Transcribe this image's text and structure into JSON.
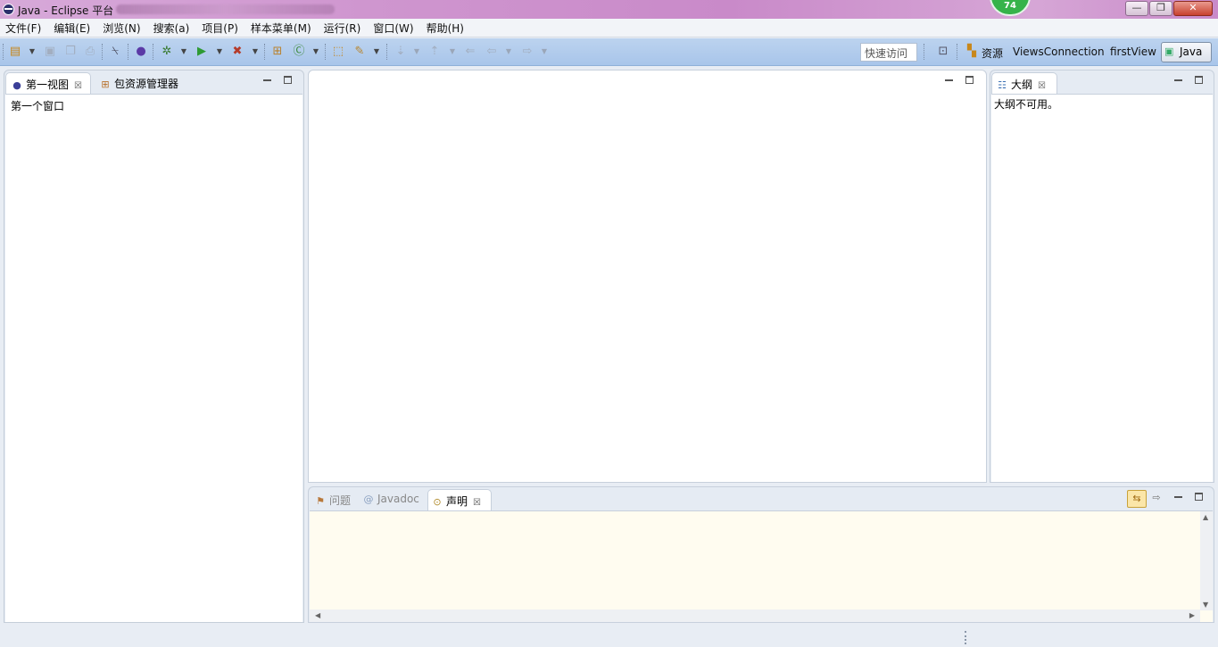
{
  "window": {
    "title": "Java - Eclipse 平台",
    "badge": "74",
    "controls": {
      "minimize": "—",
      "restore": "❐",
      "close": "✕"
    }
  },
  "menubar": {
    "items": [
      "文件(F)",
      "编辑(E)",
      "浏览(N)",
      "搜索(a)",
      "项目(P)",
      "样本菜单(M)",
      "运行(R)",
      "窗口(W)",
      "帮助(H)"
    ]
  },
  "toolbar": {
    "quick_access": "快速访问",
    "perspectives": {
      "resource": "资源",
      "views_connection": "ViewsConnection",
      "first_view": "firstView",
      "java": "Java"
    }
  },
  "left_panel": {
    "tabs": [
      {
        "label": "第一视图",
        "icon": "eclipse-view-icon",
        "active": true
      },
      {
        "label": "包资源管理器",
        "icon": "package-explorer-icon",
        "active": false
      }
    ],
    "content": "第一个窗口"
  },
  "outline_panel": {
    "tab_label": "大纲",
    "content": "大纲不可用。"
  },
  "bottom_panel": {
    "tabs": [
      {
        "label": "问题",
        "icon": "problems-icon",
        "active": false
      },
      {
        "label": "Javadoc",
        "icon": "javadoc-at-icon",
        "active": false
      },
      {
        "label": "声明",
        "icon": "declaration-icon",
        "active": true
      }
    ]
  }
}
